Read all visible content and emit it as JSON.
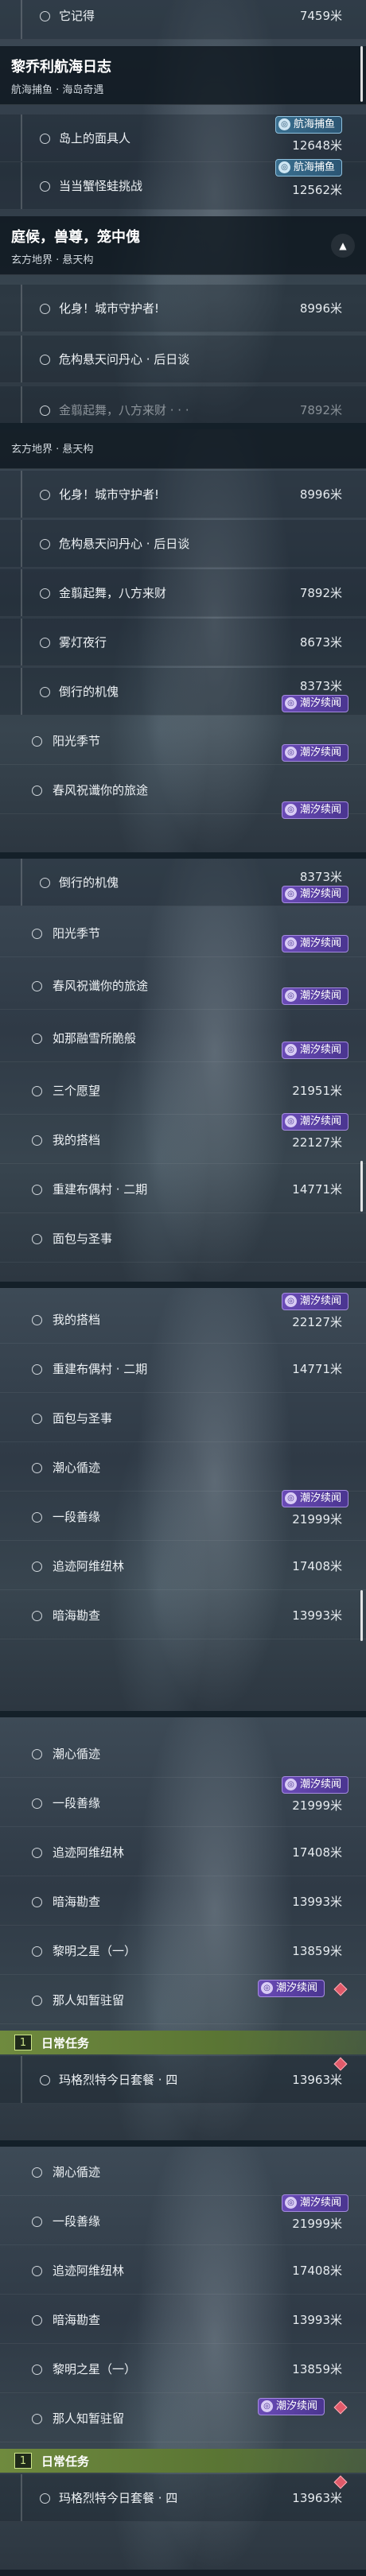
{
  "colors": {
    "badge_purple": "#6a4bb6",
    "badge_teal": "#3a6f8f",
    "daily_green": "#6f8a3e",
    "track_diamond": "#e05a6a"
  },
  "icons": {
    "task": "circle-outline-icon",
    "collapse": "chevron-up-icon",
    "tide": "tide-icon",
    "daily": "book-icon",
    "track": "diamond-icon"
  },
  "tasks": {
    "t_forgot": {
      "name": "它记得",
      "dist": "7459米"
    },
    "t_island": {
      "name": "岛上的面具人",
      "dist": "12648米"
    },
    "t_crab": {
      "name": "当当蟹怪蛙挑战",
      "dist": "12562米"
    },
    "t_guardian": {
      "name": "化身！城市守护者!",
      "dist": "8996米"
    },
    "t_danger": {
      "name": "危构悬天问丹心 · 后日谈",
      "dist": ""
    },
    "t_gold": {
      "name": "金翦起舞，八方来财",
      "dist": "7892米"
    },
    "t_fog": {
      "name": "雾灯夜行",
      "dist": "8673米"
    },
    "t_puppet": {
      "name": "倒行的机傀",
      "dist": "8373米"
    },
    "t_solar": {
      "name": "阳光季节",
      "dist": ""
    },
    "t_spring": {
      "name": "春风祝谶你的旅途",
      "dist": ""
    },
    "t_dream": {
      "name": "如那融雪所脆般",
      "dist": ""
    },
    "t_wish": {
      "name": "三个愿望",
      "dist": "21951米"
    },
    "t_flag": {
      "name": "我的搭档",
      "dist": "22127米"
    },
    "t_rebuild": {
      "name": "重建布偶村 · 二期",
      "dist": "14771米"
    },
    "t_bread": {
      "name": "面包与圣事",
      "dist": ""
    },
    "t_heart": {
      "name": "潮心循迹",
      "dist": ""
    },
    "t_good": {
      "name": "一段善缘",
      "dist": "21999米"
    },
    "t_chase": {
      "name": "追迹阿维纽林",
      "dist": "17408米"
    },
    "t_tide": {
      "name": "暗海勘查",
      "dist": "13993米"
    },
    "t_dawn": {
      "name": "黎明之星（一）",
      "dist": "13859米"
    },
    "t_stay": {
      "name": "那人知暂驻留",
      "dist": ""
    },
    "t_daily4": {
      "name": "玛格烈特今日套餐 · 四",
      "dist": "13963米"
    }
  },
  "headers": {
    "h_lily": {
      "title": "黎乔利航海日志",
      "sub": "航海捕鱼 · 海岛奇遇"
    },
    "h_garden": {
      "title": "庭候，兽尊，笼中傀",
      "sub": "玄方地界 · 悬天构"
    }
  },
  "badges": {
    "tide": "潮汐续闻",
    "nav": "航海捕鱼"
  },
  "daily": {
    "num": "1",
    "label": "日常任务"
  },
  "partial_text": {
    "cut_row_1": "金翦起舞，八方来财 · · ·",
    "cut_row_dist": "7892米"
  }
}
